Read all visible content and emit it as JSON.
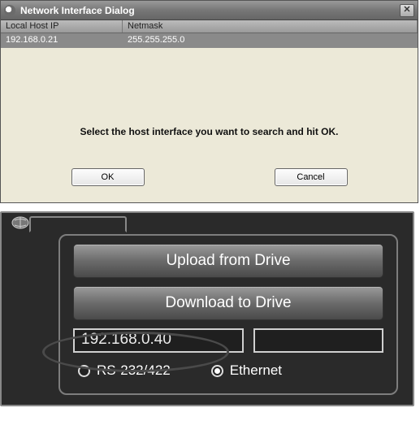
{
  "dialog": {
    "title": "Network Interface Dialog",
    "columns": {
      "ip": "Local Host IP",
      "netmask": "Netmask"
    },
    "row": {
      "ip": "192.168.0.21",
      "netmask": "255.255.255.0"
    },
    "instruction": "Select the host interface you want to search and hit OK.",
    "ok_label": "OK",
    "cancel_label": "Cancel"
  },
  "drive_panel": {
    "upload_label": "Upload from Drive",
    "download_label": "Download to Drive",
    "ip_value": "192.168.0.40",
    "radio_serial": "RS-232/422",
    "radio_ethernet": "Ethernet",
    "selected_radio": "ethernet"
  }
}
